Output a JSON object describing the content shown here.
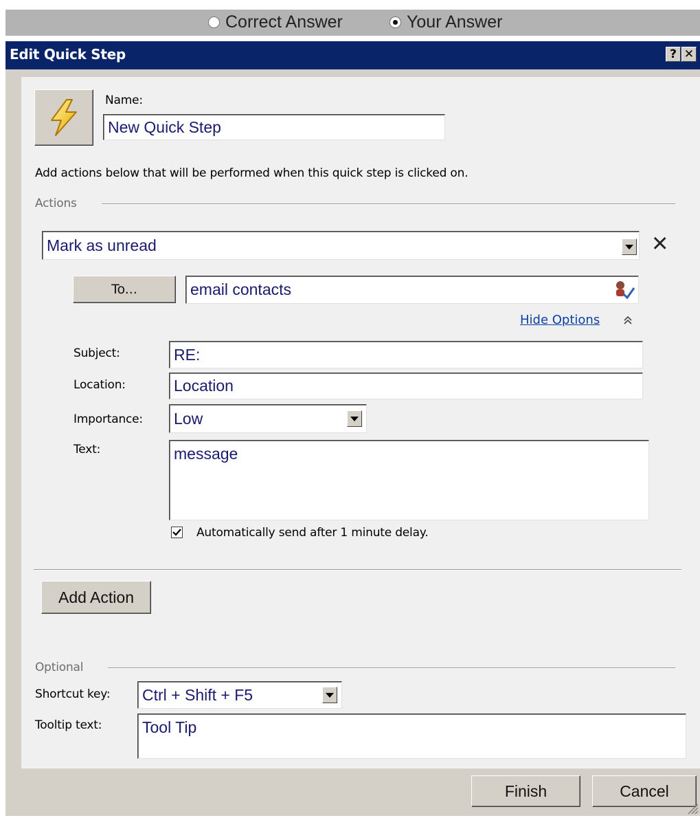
{
  "answer_toggle": {
    "correct_label": "Correct Answer",
    "your_label": "Your Answer",
    "selected": "Your Answer"
  },
  "dialog": {
    "title": "Edit Quick Step",
    "help_label": "?",
    "close_label": "✕"
  },
  "name_field": {
    "label": "Name:",
    "value": "New Quick Step",
    "icon": "lightning-bolt-icon"
  },
  "instructions": "Add actions below that will be performed when this quick step is clicked on.",
  "actions_section": {
    "label": "Actions",
    "action_value": "Mark as unread",
    "remove_label": "×",
    "to_button_label": "To...",
    "to_value": "email contacts",
    "hide_options_label": "Hide Options",
    "chevron": "⌃"
  },
  "options": {
    "subject_label": "Subject:",
    "subject_value": "RE:",
    "location_label": "Location:",
    "location_value": "Location",
    "importance_label": "Importance:",
    "importance_value": "Low",
    "text_label": "Text:",
    "text_value": "message",
    "auto_send_label": "Automatically send after 1 minute delay.",
    "auto_send_checked": true
  },
  "add_action_label": "Add Action",
  "optional_section": {
    "label": "Optional",
    "shortcut_label": "Shortcut key:",
    "shortcut_value": "Ctrl + Shift + F5",
    "tooltip_label": "Tooltip text:",
    "tooltip_value": "Tool Tip"
  },
  "footer": {
    "finish_label": "Finish",
    "cancel_label": "Cancel"
  },
  "colors": {
    "titlebar": "#0a246a",
    "dialog_bg": "#d4d0c8",
    "panel_bg": "#f0f0f0"
  }
}
